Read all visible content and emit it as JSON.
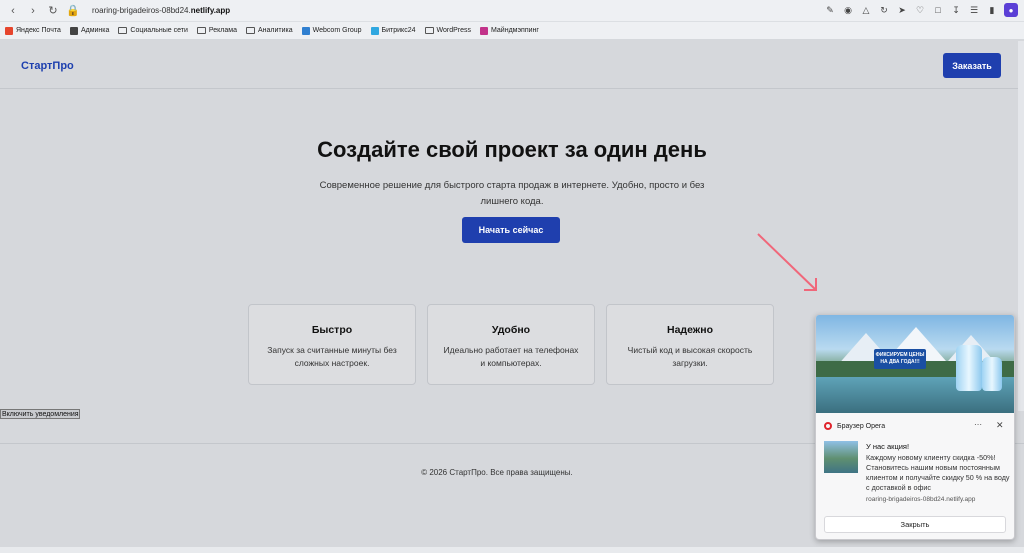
{
  "browser": {
    "url_prefix": "roaring-brigadeiros-08bd24.",
    "url_domain": "netlify.app",
    "bookmarks": [
      {
        "label": "Яндекс Почта",
        "color": "#e6452d"
      },
      {
        "label": "Админка",
        "color": "#444444"
      },
      {
        "label": "Социальные сети",
        "folder": true
      },
      {
        "label": "Реклама",
        "folder": true
      },
      {
        "label": "Аналитика",
        "folder": true
      },
      {
        "label": "Webcom Group",
        "color": "#2f7fd0"
      },
      {
        "label": "Битрикс24",
        "color": "#2fa7e0"
      },
      {
        "label": "WordPress",
        "folder": true
      },
      {
        "label": "Майндмэппинг",
        "color": "#c2338a"
      }
    ]
  },
  "site": {
    "logo": "СтартПро",
    "order_button": "Заказать",
    "hero_title": "Создайте свой проект за один день",
    "hero_subtitle": "Современное решение для быстрого старта продаж в интернете. Удобно, просто и без лишнего кода.",
    "start_button": "Начать сейчас",
    "features": [
      {
        "title": "Быстро",
        "text": "Запуск за считанные минуты без сложных настроек."
      },
      {
        "title": "Удобно",
        "text": "Идеально работает на телефонах и компьютерах."
      },
      {
        "title": "Надежно",
        "text": "Чистый код и высокая скорость загрузки."
      }
    ],
    "notif_button": "Включить уведомления",
    "footer": "© 2026 СтартПро. Все права защищены."
  },
  "toast": {
    "app": "Браузер Opera",
    "title": "У нас акция!",
    "body": "Каждому новому клиенту скидка -50%! Становитесь нашим новым постоянным клиентом и получайте скидку 50 % на воду с доставкой в офис",
    "source": "roaring-brigadeiros-08bd24.netlify.app",
    "close_button": "Закрыть",
    "banner_text": "ФИКСИРУЕМ ЦЕНЫ НА ДВА ГОДА!!!"
  },
  "colors": {
    "accent": "#1f3fae",
    "arrow": "#f0677a"
  }
}
